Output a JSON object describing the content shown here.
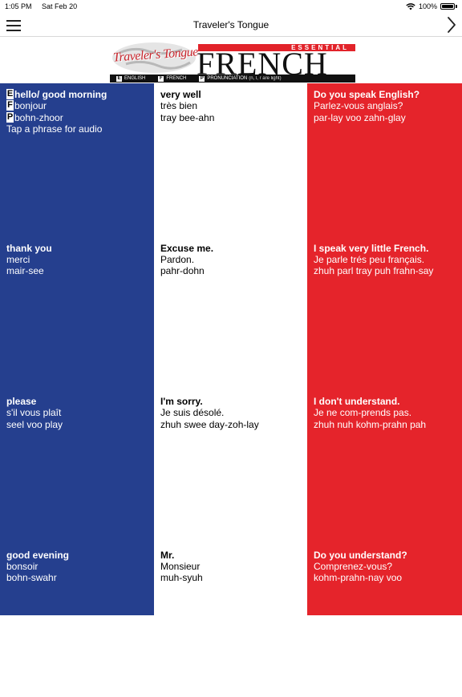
{
  "status": {
    "time": "1:05 PM",
    "date": "Sat Feb 20",
    "battery": "100%"
  },
  "nav": {
    "title": "Traveler's Tongue"
  },
  "banner": {
    "logo_text": "Traveler's Tongue",
    "essential": "ESSENTIAL",
    "language": "FRENCH",
    "legend": [
      {
        "key": "E",
        "label": "ENGLISH"
      },
      {
        "key": "F",
        "label": "FRENCH"
      },
      {
        "key": "P",
        "label": "PRONUNCIATION",
        "note": "(n, l, r are light)"
      }
    ]
  },
  "colors": {
    "blue": "#253f8e",
    "white": "#ffffff",
    "red": "#e5242b"
  },
  "first_cell_keys": [
    "E",
    "F",
    "P"
  ],
  "hint": "Tap a phrase for audio",
  "phrases": [
    [
      {
        "en": "hello/ good morning",
        "fr": "bonjour",
        "pr": "bohn-zhoor"
      },
      {
        "en": "thank you",
        "fr": "merci",
        "pr": "mair-see"
      },
      {
        "en": "please",
        "fr": "s'il vous plaît",
        "pr": "seel voo play"
      },
      {
        "en": "good evening",
        "fr": "bonsoir",
        "pr": "bohn-swahr"
      }
    ],
    [
      {
        "en": "very well",
        "fr": "très bien",
        "pr": "tray bee-ahn"
      },
      {
        "en": "Excuse me.",
        "fr": "Pardon.",
        "pr": "pahr-dohn"
      },
      {
        "en": "I'm sorry.",
        "fr": "Je suis désolé.",
        "pr": "zhuh swee day-zoh-lay"
      },
      {
        "en": "Mr.",
        "fr": "Monsieur",
        "pr": "muh-syuh"
      }
    ],
    [
      {
        "en": "Do you speak English?",
        "fr": "Parlez-vous anglais?",
        "pr": "par-lay voo zahn-glay"
      },
      {
        "en": "I speak very little French.",
        "fr": "Je parle trés peu français.",
        "pr": "zhuh parl tray puh frahn-say"
      },
      {
        "en": "I don't understand.",
        "fr": "Je ne com-prends pas.",
        "pr": "zhuh nuh kohm-prahn pah"
      },
      {
        "en": "Do you understand?",
        "fr": "Comprenez-vous?",
        "pr": "kohm-prahn-nay voo"
      }
    ]
  ]
}
